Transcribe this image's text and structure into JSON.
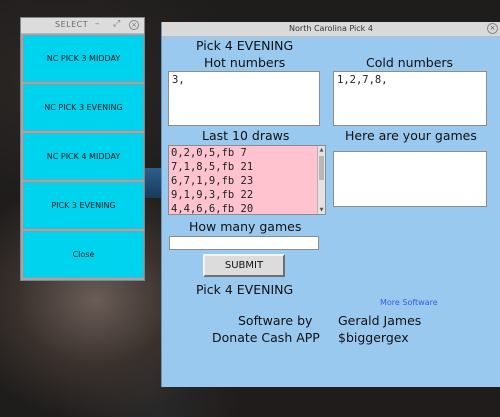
{
  "select_window": {
    "title": "SELECT",
    "buttons": [
      "NC PICK 3 MIDDAY",
      "NC PICK 3 EVENING",
      "NC PICK 4 MIDDAY",
      "PICK 3 EVENING",
      "Close"
    ]
  },
  "main_window": {
    "title": "North Carolina Pick 4",
    "heading": "Pick 4 EVENING",
    "hot_label": "Hot numbers",
    "hot_value": "3,",
    "cold_label": "Cold numbers",
    "cold_value": "1,2,7,8,",
    "last_draws_label": "Last 10 draws",
    "last_draws": [
      "0,2,0,5,fb 7",
      "7,1,8,5,fb 21",
      "6,7,1,9,fb 23",
      "9,1,9,3,fb 22",
      "4,4,6,6,fb 20"
    ],
    "games_label": "Here are your games",
    "games_value": "",
    "how_many_label": "How many games",
    "how_many_value": "",
    "submit_label": "SUBMIT",
    "footer_heading": "Pick 4 EVENING",
    "more_software": "More Software",
    "software_by_label": "Software by",
    "author": "Gerald James",
    "donate_label": "Donate Cash APP",
    "cashtag": "$biggergex"
  },
  "colors": {
    "select_button": "#00d3ee",
    "main_background": "#99c9ee",
    "draws_background": "#ffc3cf",
    "link": "#3d5ce0"
  }
}
